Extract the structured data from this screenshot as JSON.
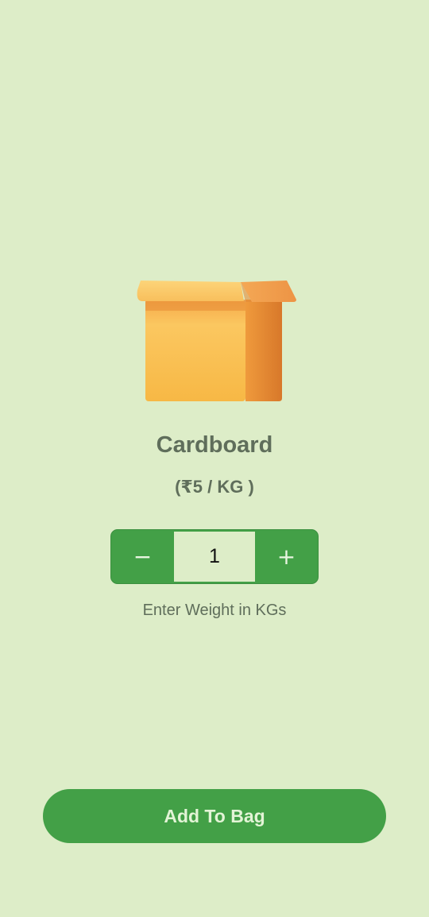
{
  "product": {
    "icon": "cardboard-box-icon",
    "name": "Cardboard",
    "price_label": "(₹5 / KG )"
  },
  "weight_stepper": {
    "decrement_symbol": "−",
    "value": "1",
    "increment_symbol": "+",
    "helper_text": "Enter Weight in KGs"
  },
  "actions": {
    "add_to_bag_label": "Add To Bag"
  },
  "colors": {
    "background": "#ddedc8",
    "accent": "#43a047",
    "text_muted": "#5f6e5b"
  }
}
